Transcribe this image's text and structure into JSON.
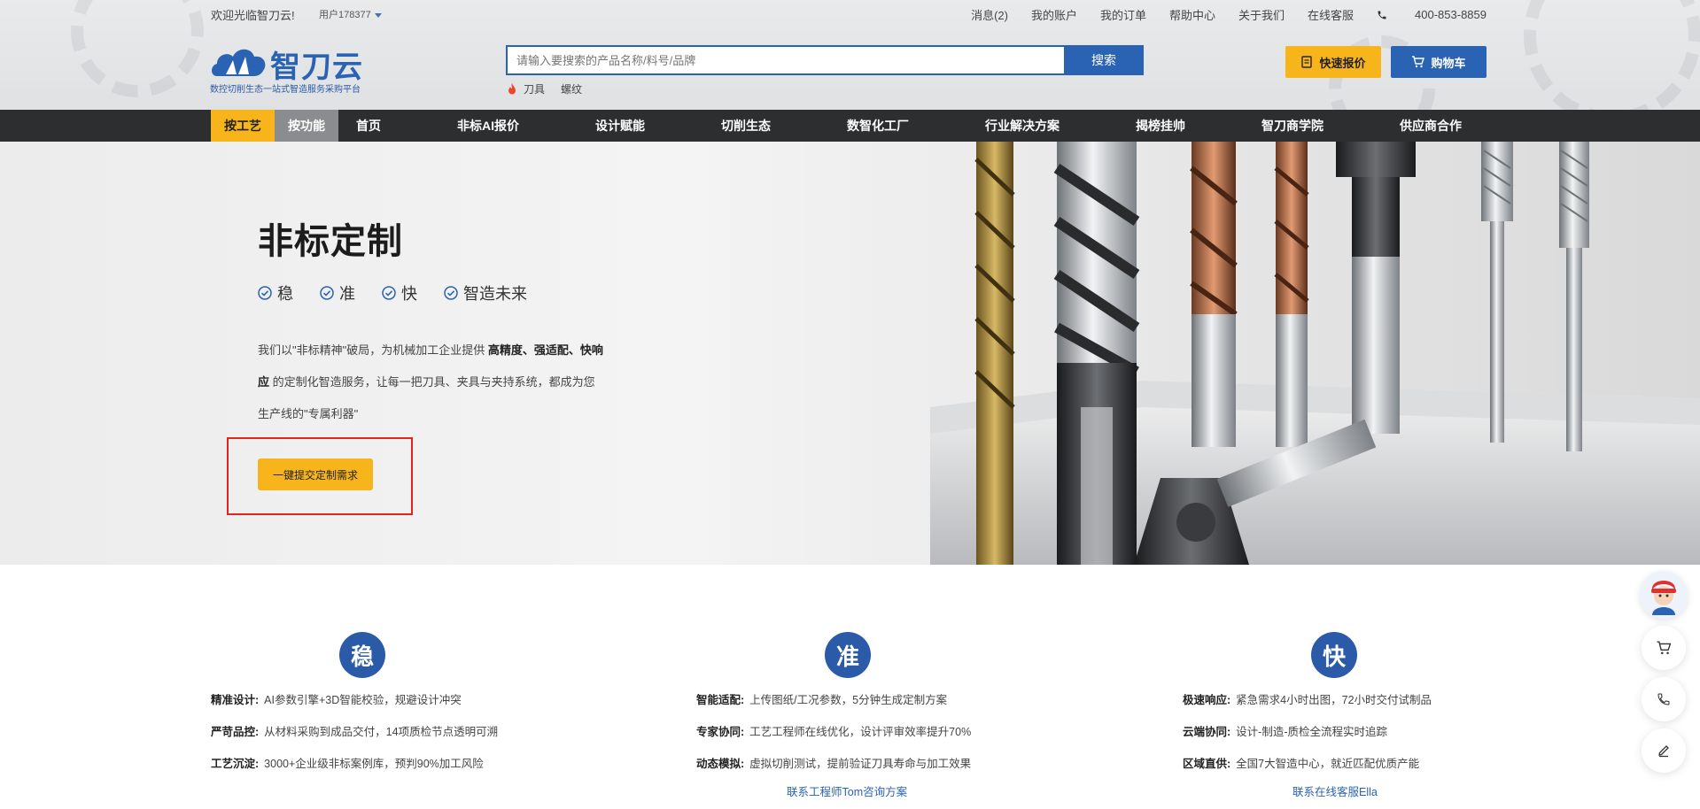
{
  "topbar": {
    "welcome": "欢迎光临智刀云!",
    "user": "用户178377",
    "links": [
      "消息(2)",
      "我的账户",
      "我的订单",
      "帮助中心",
      "关于我们",
      "在线客服"
    ],
    "phone": "400-853-8859"
  },
  "logo": {
    "brand": "智刀云",
    "slogan": "数控切削生态一站式智造服务采购平台"
  },
  "search": {
    "placeholder": "请输入要搜索的产品名称/料号/品牌",
    "button": "搜索",
    "hot": [
      "刀具",
      "螺纹"
    ]
  },
  "header_buttons": {
    "quote": "快速报价",
    "cart": "购物车"
  },
  "nav": {
    "seg1": "按工艺",
    "seg2": "按功能",
    "items": [
      "首页",
      "非标AI报价",
      "设计赋能",
      "切削生态",
      "数智化工厂",
      "行业解决方案",
      "揭榜挂帅",
      "智刀商学院",
      "供应商合作"
    ]
  },
  "hero": {
    "title": "非标定制",
    "tags": [
      "稳",
      "准",
      "快",
      "智造未来"
    ],
    "desc": {
      "p1": "我们以\"非标精神\"破局，为机械加工企业提供 ",
      "b1": "高精度、强适配、快响应",
      "p2": " 的定制化智造服务，让每一把刀具、夹具与夹持系统，都成为您生产线的\"专属利器\""
    },
    "button": "一键提交定制需求"
  },
  "features": [
    {
      "badge": "稳",
      "rows": [
        {
          "label": "精准设计:",
          "text": "AI参数引擎+3D智能校验，规避设计冲突"
        },
        {
          "label": "严苛品控:",
          "text": "从材料采购到成品交付，14项质检节点透明可溯"
        },
        {
          "label": "工艺沉淀:",
          "text": "3000+企业级非标案例库，预判90%加工风险"
        }
      ],
      "contact": ""
    },
    {
      "badge": "准",
      "rows": [
        {
          "label": "智能适配:",
          "text": "上传图纸/工况参数，5分钟生成定制方案"
        },
        {
          "label": "专家协同:",
          "text": "工艺工程师在线优化，设计评审效率提升70%"
        },
        {
          "label": "动态模拟:",
          "text": "虚拟切削测试，提前验证刀具寿命与加工效果"
        }
      ],
      "contact": "联系工程师Tom咨询方案"
    },
    {
      "badge": "快",
      "rows": [
        {
          "label": "极速响应:",
          "text": "紧急需求4小时出图，72小时交付试制品"
        },
        {
          "label": "云端协同:",
          "text": "设计-制造-质检全流程实时追踪"
        },
        {
          "label": "区域直供:",
          "text": "全国7大智造中心，就近匹配优质产能"
        }
      ],
      "contact": "联系在线客服Ella"
    }
  ],
  "colors": {
    "brand_blue": "#2a63b3",
    "accent_yellow": "#f7b51b",
    "nav_dark": "#2d2e30",
    "highlight_red": "#e52222"
  },
  "icons": [
    "flame-icon",
    "phone-icon",
    "quote-icon",
    "cart-icon",
    "check-badge-icon",
    "headset-avatar",
    "phone-circle-icon",
    "edit-icon"
  ]
}
